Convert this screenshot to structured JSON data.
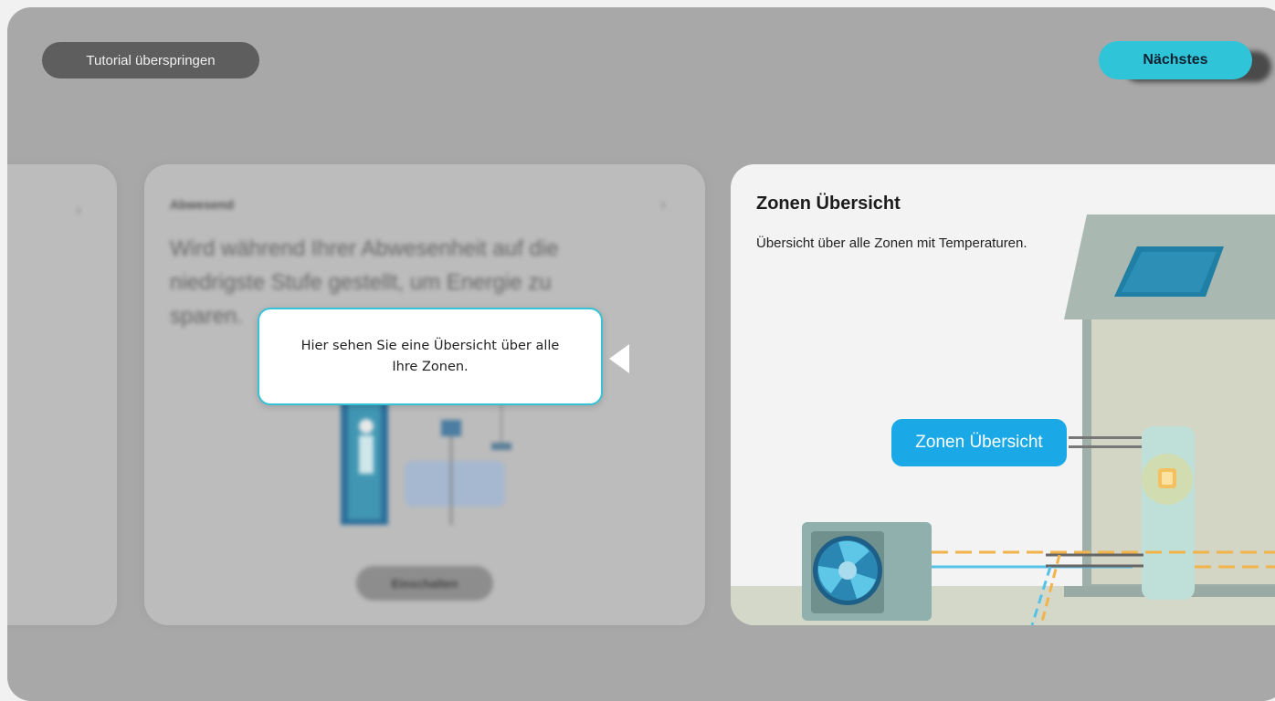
{
  "header": {
    "skip_label": "Tutorial überspringen",
    "next_label": "Nächstes"
  },
  "background_cards": {
    "mid": {
      "title": "Abwesend",
      "description": "Wird während Ihrer Abwesenheit auf die niedrigste Stufe gestellt, um Energie zu sparen.",
      "button_label": "Einschalten"
    }
  },
  "tooltip": {
    "text": "Hier sehen Sie eine Übersicht über alle Ihre Zonen."
  },
  "highlight_card": {
    "title": "Zonen Übersicht",
    "description": "Übersicht über alle Zonen mit Temperaturen.",
    "zone_label": "Zonen Übersicht"
  },
  "colors": {
    "accent": "#30c4d8",
    "zone_pill": "#1aa9e6",
    "overlay": "#a8a8a8"
  }
}
